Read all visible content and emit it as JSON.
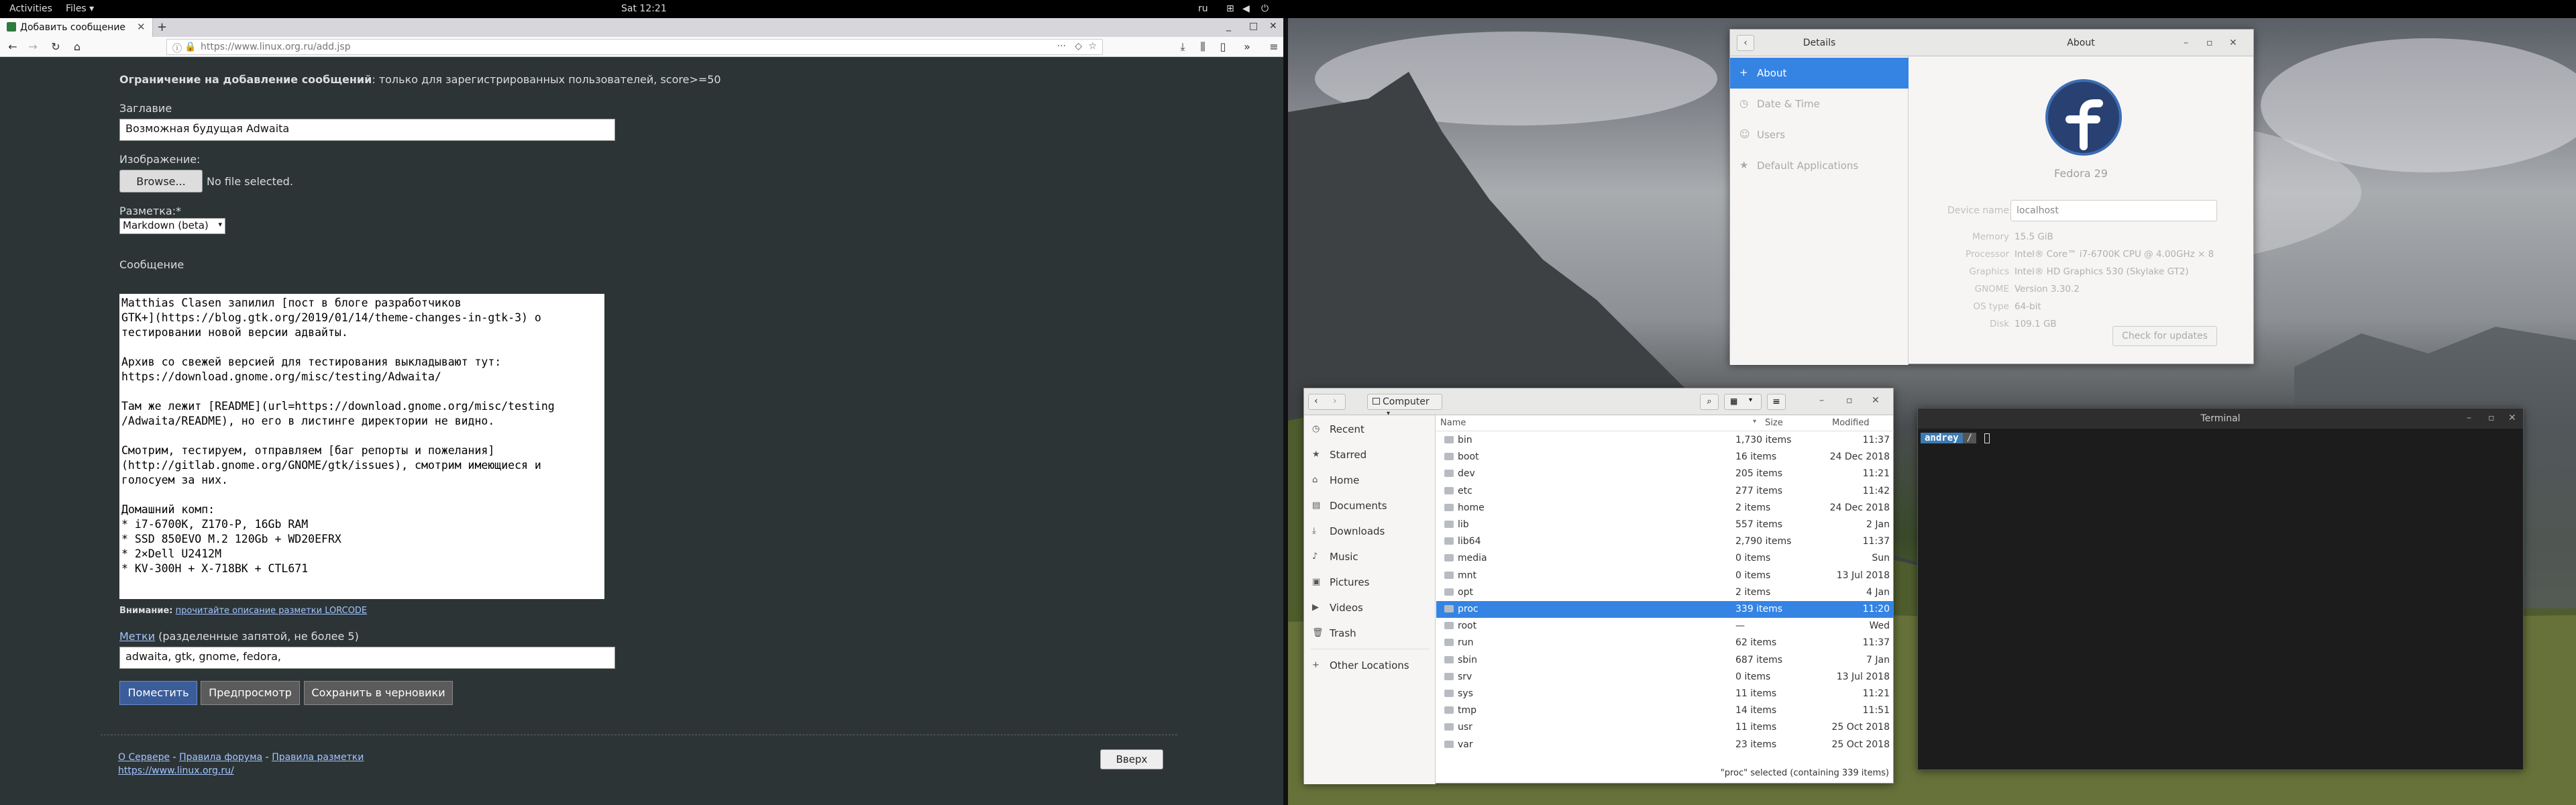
{
  "topbar": {
    "activities": "Activities",
    "files_menu": "Files ▾",
    "clock": "Sat 12:21",
    "lang": "ru"
  },
  "firefox": {
    "tab_title": "Добавить сообщение",
    "url": "https://www.linux.org.ru/add.jsp",
    "page": {
      "restriction_label": "Ограничение на добавление сообщений",
      "restriction_value": ": только для зарегистрированных пользователей, score>=50",
      "title_label": "Заглавие",
      "title_value": "Возможная будущая Adwaita",
      "image_label": "Изображение:",
      "browse_button": "Browse...",
      "no_file": "No file selected.",
      "markup_label": "Разметка:*",
      "markup_value": "Markdown (beta)",
      "message_label": "Сообщение",
      "message_text": "Matthias Clasen запилил [пост в блоге разработчиков\nGTK+](https://blog.gtk.org/2019/01/14/theme-changes-in-gtk-3) о\nтестировании новой версии адвайты.\n\nАрхив со свежей версией для тестирования выкладывают тут:\nhttps://download.gnome.org/misc/testing/Adwaita/\n\nТам же лежит [README](url=https://download.gnome.org/misc/testing\n/Adwaita/README), но его в листинге директории не видно.\n\nСмотрим, тестируем, отправляем [баг репорты и пожелания]\n(http://gitlab.gnome.org/GNOME/gtk/issues), смотрим имеющиеся и\nголосуем за них.\n\nДомашний комп:\n* i7-6700K, Z170-P, 16Gb RAM\n* SSD 850EVO M.2 120Gb + WD20EFRX\n* 2×Dell U2412M\n* KV-300H + X-718BK + CTL671",
      "note_prefix": "Внимание:",
      "note_link": "прочитайте описание разметки LORCODE",
      "tags_link": "Метки",
      "tags_hint": " (разделенные запятой, не более 5)",
      "tags_value": "adwaita, gtk, gnome, fedora,",
      "btn_post": "Поместить",
      "btn_preview": "Предпросмотр",
      "btn_draft": "Сохранить в черновики",
      "footer_links": [
        "О Сервере",
        "Правила форума",
        "Правила разметки"
      ],
      "footer_url": "https://www.linux.org.ru/",
      "btn_top": "Вверх"
    }
  },
  "about": {
    "details_title": "Details",
    "about_title": "About",
    "sidebar": [
      "About",
      "Date & Time",
      "Users",
      "Default Applications"
    ],
    "os_name": "Fedora 29",
    "device_name_label": "Device name",
    "device_name": "localhost",
    "rows": [
      {
        "k": "Memory",
        "v": "15.5 GiB"
      },
      {
        "k": "Processor",
        "v": "Intel® Core™ i7-6700K CPU @ 4.00GHz × 8"
      },
      {
        "k": "Graphics",
        "v": "Intel® HD Graphics 530 (Skylake GT2)"
      },
      {
        "k": "GNOME",
        "v": "Version 3.30.2"
      },
      {
        "k": "OS type",
        "v": "64-bit"
      },
      {
        "k": "Disk",
        "v": "109.1 GB"
      }
    ],
    "check_updates": "Check for updates"
  },
  "files": {
    "location": "Computer",
    "sidebar": [
      "Recent",
      "Starred",
      "Home",
      "Documents",
      "Downloads",
      "Music",
      "Pictures",
      "Videos",
      "Trash",
      "Other Locations"
    ],
    "col_name": "Name",
    "col_size": "Size",
    "col_modified": "Modified",
    "rows": [
      {
        "name": "bin",
        "size": "1,730 items",
        "mod": "11:37"
      },
      {
        "name": "boot",
        "size": "16 items",
        "mod": "24 Dec 2018"
      },
      {
        "name": "dev",
        "size": "205 items",
        "mod": "11:21"
      },
      {
        "name": "etc",
        "size": "277 items",
        "mod": "11:42"
      },
      {
        "name": "home",
        "size": "2 items",
        "mod": "24 Dec 2018"
      },
      {
        "name": "lib",
        "size": "557 items",
        "mod": "2 Jan"
      },
      {
        "name": "lib64",
        "size": "2,790 items",
        "mod": "11:37"
      },
      {
        "name": "media",
        "size": "0 items",
        "mod": "Sun"
      },
      {
        "name": "mnt",
        "size": "0 items",
        "mod": "13 Jul 2018"
      },
      {
        "name": "opt",
        "size": "2 items",
        "mod": "4 Jan"
      },
      {
        "name": "proc",
        "size": "339 items",
        "mod": "11:20"
      },
      {
        "name": "root",
        "size": "—",
        "mod": "Wed"
      },
      {
        "name": "run",
        "size": "62 items",
        "mod": "11:37"
      },
      {
        "name": "sbin",
        "size": "687 items",
        "mod": "7 Jan"
      },
      {
        "name": "srv",
        "size": "0 items",
        "mod": "13 Jul 2018"
      },
      {
        "name": "sys",
        "size": "11 items",
        "mod": "11:21"
      },
      {
        "name": "tmp",
        "size": "14 items",
        "mod": "11:51"
      },
      {
        "name": "usr",
        "size": "11 items",
        "mod": "25 Oct 2018"
      },
      {
        "name": "var",
        "size": "23 items",
        "mod": "25 Oct 2018"
      }
    ],
    "selected": "proc",
    "status": "\"proc\" selected (containing 339 items)"
  },
  "terminal": {
    "title": "Terminal",
    "prompt_user": "andrey",
    "prompt_dir": "/"
  }
}
